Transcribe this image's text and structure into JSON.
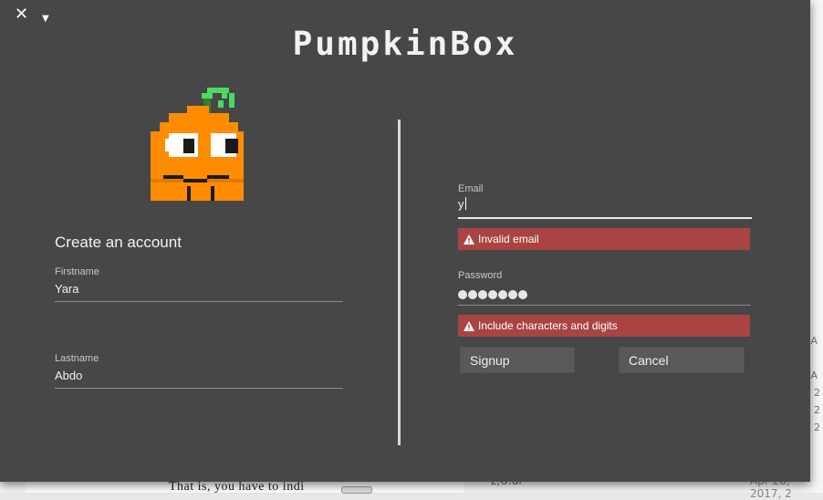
{
  "window": {
    "app_title": "PumpkinBox",
    "close_glyph": "✕",
    "menu_glyph": "▼"
  },
  "left": {
    "heading": "Create an account",
    "firstname": {
      "label": "Firstname",
      "value": "Yara"
    },
    "lastname": {
      "label": "Lastname",
      "value": "Abdo"
    }
  },
  "right": {
    "email": {
      "label": "Email",
      "value": "y",
      "error": "Invalid email"
    },
    "password": {
      "label": "Password",
      "masked_length": 7,
      "error": "Include characters and digits"
    },
    "signup_label": "Signup",
    "cancel_label": "Cancel"
  },
  "background": {
    "text": "That is, you have to indi",
    "file": "z,U.ul",
    "file_date": "Apr 28, 2017, 2",
    "side_list": [
      "d",
      "4 A",
      "7:",
      "4 A",
      "7, 2",
      "7, 2",
      "7, 2"
    ]
  },
  "colors": {
    "window_bg": "#474747",
    "error_bg": "#a94442",
    "pumpkin_orange": "#ff8c00",
    "stem_green": "#4cd964"
  },
  "icons": {
    "close": "close-icon",
    "menu": "chevron-down-icon",
    "warning": "warning-icon",
    "logo": "pumpkin-logo"
  }
}
